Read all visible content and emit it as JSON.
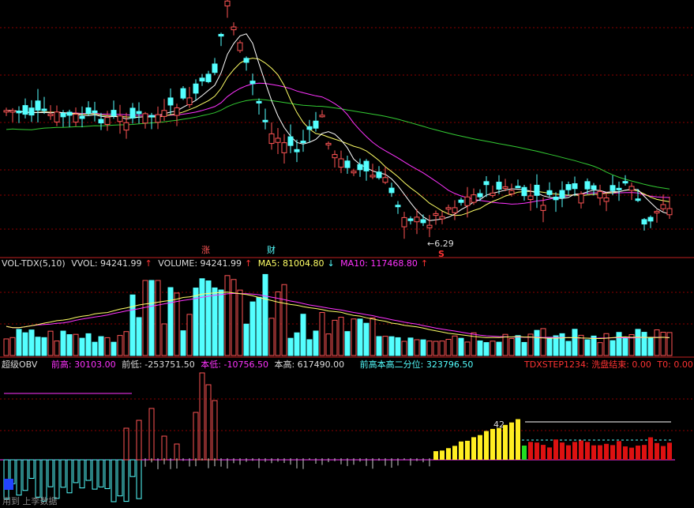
{
  "colors": {
    "up": "#ff5555",
    "down": "#54ffff",
    "ma_short": "#ffffff",
    "ma_mid": "#ffff66",
    "ma_purple": "#ff33ff",
    "ma_long": "#33cc33",
    "grid": "#8b0000",
    "obv_yellow": "#ffee22",
    "obv_red": "#dd1111",
    "obv_green": "#22dd22"
  },
  "price_panel": {
    "low_label": "6.29",
    "markers": {
      "zhang": "涨",
      "cai": "财",
      "s": "S"
    }
  },
  "vol_panel": {
    "label": "VOL-TDX(5,10)",
    "vvol": "VVOL: 94241.99",
    "volume": "VOLUME: 94241.99",
    "ma5": "MA5: 81004.80",
    "ma10": "MA10: 117468.80",
    "arrow_up": "↑",
    "arrow_down": "↓"
  },
  "obv_panel": {
    "label": "超级OBV",
    "qiangao": "前高: 30103.00",
    "qiandi": "前低: -253751.50",
    "bendi": "本低: -10756.50",
    "bengao": "本高: 617490.00",
    "erfenwei": "前高本高二分位: 323796.50",
    "tdxstep": "TDXSTEP1234: ",
    "xipan": "洗盘结束: 0.00",
    "t0": "T0: 0.00",
    "peak_label": "42"
  },
  "watermark": "用到 上李数据",
  "chart_data": [
    {
      "type": "candlestick",
      "series": [
        {
          "name": "MA5",
          "values": []
        },
        {
          "name": "MA10",
          "values": []
        }
      ],
      "low_annotation": 6.29
    },
    {
      "type": "bar",
      "series": [
        {
          "name": "VOLUME",
          "values": [
            94241.99
          ]
        },
        {
          "name": "MA5",
          "values": [
            81004.8
          ]
        },
        {
          "name": "MA10",
          "values": [
            117468.8
          ]
        }
      ]
    },
    {
      "type": "bar",
      "series": [
        {
          "name": "超级OBV",
          "values": []
        }
      ],
      "qiangao": 30103.0,
      "qiandi": -253751.5,
      "bendi": -10756.5,
      "bengao": 617490.0,
      "erfenwei": 323796.5,
      "xipan": 0.0,
      "t0": 0.0
    }
  ]
}
